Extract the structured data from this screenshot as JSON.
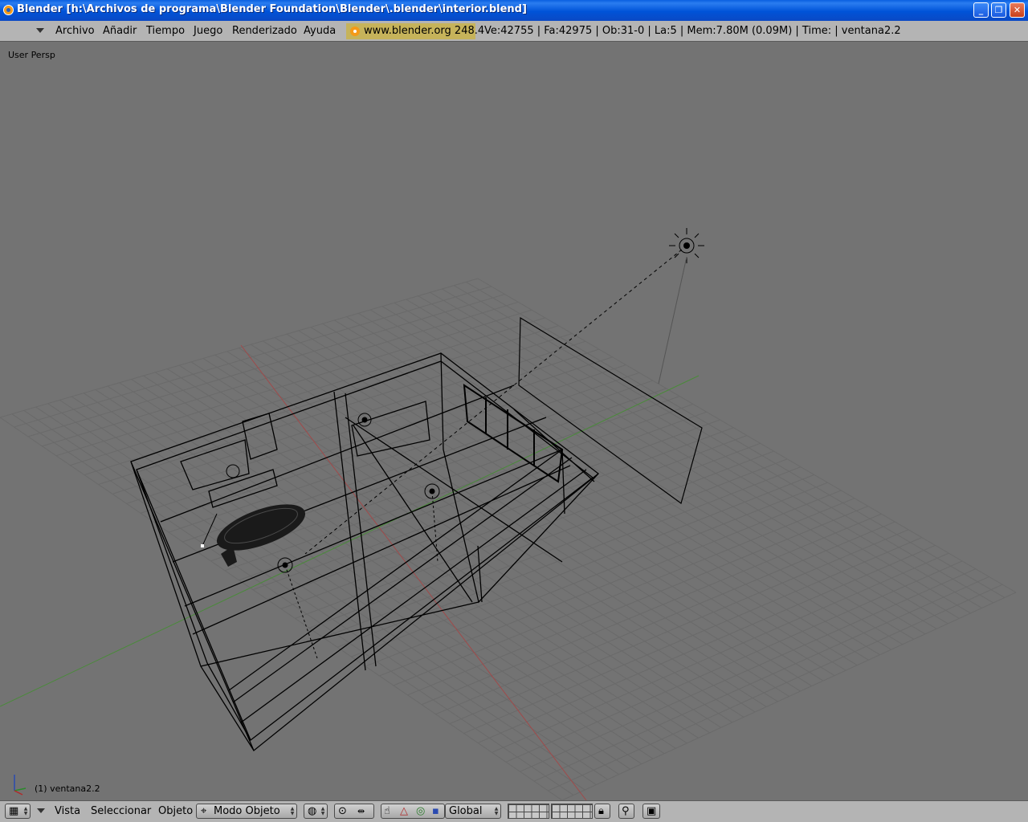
{
  "window": {
    "title": "Blender [h:\\Archivos de programa\\Blender Foundation\\Blender\\.blender\\interior.blend]",
    "buttons": {
      "minimize": "_",
      "maximize": "❐",
      "close": "✕"
    }
  },
  "menubar": {
    "items": [
      "Archivo",
      "Añadir",
      "Tiempo",
      "Juego",
      "Renderizado",
      "Ayuda"
    ],
    "url": "www.blender.org 248.4",
    "stats": "Ve:42755 | Fa:42975 | Ob:31-0 | La:5  | Mem:7.80M (0.09M)  | Time: | ventana2.2"
  },
  "viewport": {
    "view_label": "User Persp",
    "object_label": "(1) ventana2.2"
  },
  "bottombar": {
    "menus": [
      "Vista",
      "Seleccionar",
      "Objeto"
    ],
    "mode": "Modo Objeto",
    "orientation": "Global"
  },
  "colors": {
    "background": "#737373",
    "grid": "#6a6a6a",
    "x_axis": "#a04a4a",
    "y_axis": "#4a8a3a",
    "header": "#b4b4b4"
  }
}
